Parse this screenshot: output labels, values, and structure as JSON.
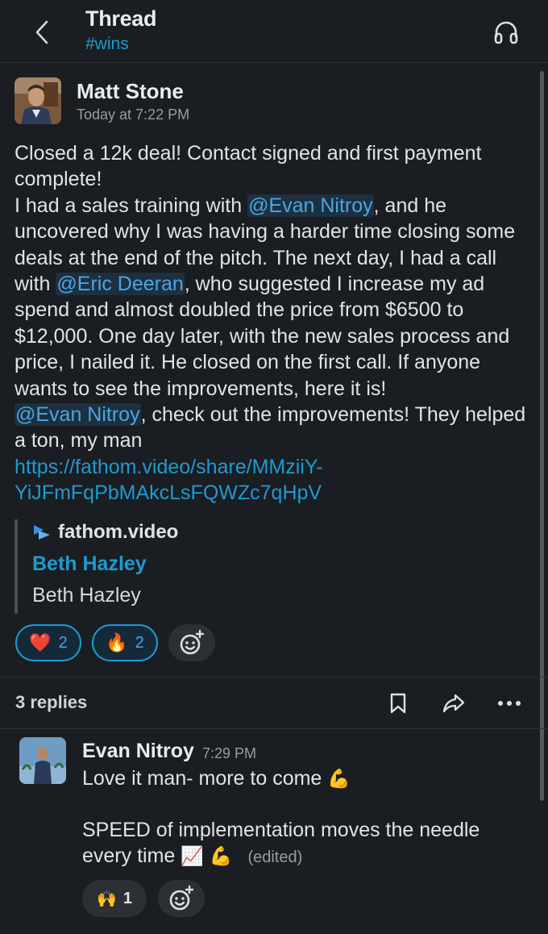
{
  "header": {
    "title": "Thread",
    "channel": "#wins"
  },
  "message": {
    "author": "Matt Stone",
    "time": "Today at 7:22 PM",
    "body": {
      "line1": "Closed a 12k deal! Contact signed and first payment complete!",
      "p2_a": "I had a sales training with ",
      "mention1": "@Evan Nitroy",
      "p2_b": ", and he uncovered why I was having a harder time closing some deals at the end of the pitch. The next day, I had a call with ",
      "mention2": "@Eric Deeran",
      "p2_c": ", who suggested I increase my ad spend and almost doubled the price from $6500 to $12,000. One day later, with the new sales process and price, I nailed it. He closed on the first call. If anyone wants to see the improvements, here it is!",
      "mention3": "@Evan Nitroy",
      "p3": ", check out the improvements! They helped a ton, my man",
      "link": "https://fathom.video/share/MMziiY-YiJFmFqPbMAkcLsFQWZc7qHpV"
    },
    "unfurl": {
      "site": "fathom.video",
      "title": "Beth Hazley",
      "description": "Beth Hazley"
    },
    "reactions": [
      {
        "emoji": "❤️",
        "count": "2",
        "icon": "heart-emoji"
      },
      {
        "emoji": "🔥",
        "count": "2",
        "icon": "fire-emoji"
      }
    ]
  },
  "thread": {
    "replies_label": "3 replies"
  },
  "reply": {
    "author": "Evan Nitroy",
    "time": "7:29 PM",
    "line1": "Love it man- more to come",
    "line1_emoji": "💪",
    "line2": "SPEED of implementation moves the needle",
    "line3": "every time",
    "line3_emoji1": "📈",
    "line3_emoji2": "💪",
    "edited": "(edited)",
    "reactions": [
      {
        "emoji": "🙌",
        "count": "1",
        "icon": "raised-hands-emoji"
      }
    ]
  },
  "colors": {
    "background": "#1a1d21",
    "link": "#1d9bd1",
    "mention_bg": "#1d3041",
    "reaction_border": "#1d9bd1"
  }
}
